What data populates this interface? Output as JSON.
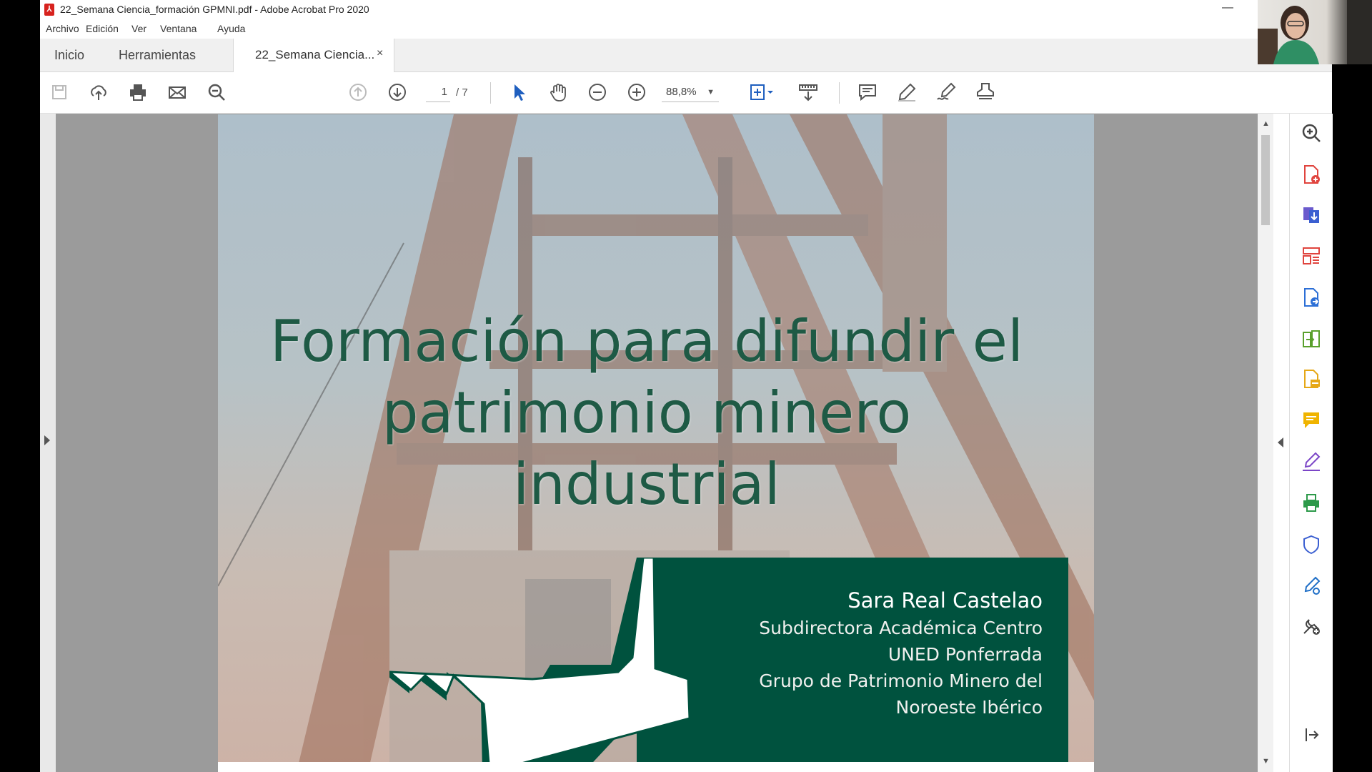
{
  "window": {
    "title": "22_Semana Ciencia_formación GPMNI.pdf - Adobe Acrobat Pro 2020",
    "minimize": "—"
  },
  "menu": [
    "Archivo",
    "Edición",
    "Ver",
    "Ventana",
    "Ayuda"
  ],
  "tabs": {
    "home": "Inicio",
    "tools": "Herramientas",
    "document": "22_Semana Ciencia...",
    "close": "×"
  },
  "toolbar": {
    "page_current": "1",
    "page_total": "/ 7",
    "zoom": "88,8%",
    "icons": [
      "save-icon",
      "upload-icon",
      "print-icon",
      "email-icon",
      "search-icon",
      "page-up-icon",
      "page-down-icon",
      "select-cursor-icon",
      "hand-icon",
      "zoom-out-icon",
      "zoom-in-icon",
      "fit-page-icon",
      "scroll-mode-icon",
      "comment-icon",
      "highlight-icon",
      "sign-icon",
      "stamp-icon"
    ]
  },
  "slide": {
    "title_lines": [
      "Formación para difundir el",
      "patrimonio minero",
      "industrial"
    ],
    "author": "Sara Real Castelao",
    "lines": [
      "Subdirectora Académica Centro",
      "UNED Ponferrada",
      "Grupo de Patrimonio Minero del",
      "Noroeste Ibérico"
    ]
  },
  "right_pane_icons": [
    "zoom-search-icon",
    "create-pdf-icon",
    "export-pdf-icon",
    "organize-pages-icon",
    "edit-pdf-icon",
    "combine-files-icon",
    "request-signature-icon",
    "comment-tool-icon",
    "fill-sign-icon",
    "print-production-icon",
    "protect-icon",
    "certificates-icon",
    "more-tools-icon",
    "collapse-pane-icon"
  ],
  "colors": {
    "slide_title": "#1e5a45",
    "slide_box": "#00523e",
    "acrobat_red": "#d7221e",
    "select_blue": "#1f5fbf"
  }
}
